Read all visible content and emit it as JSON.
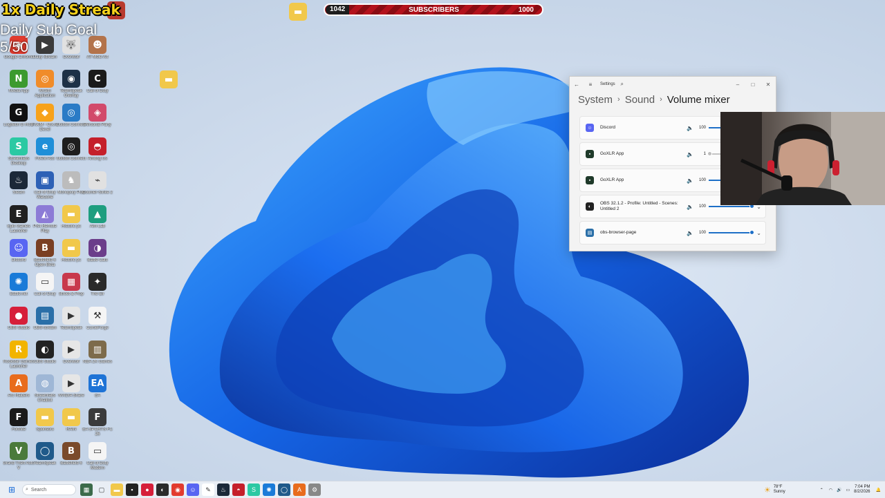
{
  "overlays": {
    "streak": "1x Daily Streak",
    "daily_goal_title": "Daily Sub Goal",
    "daily_goal_value": "5/50",
    "subs_current": "1042",
    "subs_label": "SUBSCRIBERS",
    "subs_target": "1000"
  },
  "desktop_icons": [
    {
      "label": "Google Chrome",
      "color": "#e23b2e",
      "glyph": "◉"
    },
    {
      "label": "Nvidia App",
      "color": "#3c9a2f",
      "glyph": "N"
    },
    {
      "label": "Logitech G HUB",
      "color": "#111111",
      "glyph": "G"
    },
    {
      "label": "Streamlabs Desktop",
      "color": "#2bc9a3",
      "glyph": "S"
    },
    {
      "label": "Steam",
      "color": "#1b2838",
      "glyph": "♨"
    },
    {
      "label": "Epic Games Launcher",
      "color": "#202020",
      "glyph": "E"
    },
    {
      "label": "Discord",
      "color": "#5865f2",
      "glyph": "☺"
    },
    {
      "label": "Battle.net",
      "color": "#1a7bd8",
      "glyph": "✺"
    },
    {
      "label": "OBS Studio",
      "color": "#d61f3a",
      "glyph": "●"
    },
    {
      "label": "Rockstar Games Launcher",
      "color": "#f2b400",
      "glyph": "R"
    },
    {
      "label": "Arc Raiders",
      "color": "#e86c1d",
      "glyph": "A"
    },
    {
      "label": "Fortnite",
      "color": "#1a1a1a",
      "glyph": "F"
    },
    {
      "label": "Grand Theft Auto V",
      "color": "#4a7a3b",
      "glyph": "V"
    }
  ],
  "desktop_icons_col2": [
    {
      "label": "Daily Stream",
      "color": "#3a3a3a",
      "glyph": "▶"
    },
    {
      "label": "Wraith Application",
      "color": "#f08c2a",
      "glyph": "◎"
    },
    {
      "label": "FiveM - Cfx.re Devel",
      "color": "#f7a21b",
      "glyph": "◆"
    },
    {
      "label": "FiveM Ass",
      "color": "#1f8fd8",
      "glyph": "e"
    },
    {
      "label": "Call of Duty Warzone",
      "color": "#2d61b6",
      "glyph": "▣"
    },
    {
      "label": "PS4 Remote Play",
      "color": "#8c7bd6",
      "glyph": "◭"
    },
    {
      "label": "Battlefield 6 Open Beta",
      "color": "#7a3f23",
      "glyph": "B"
    },
    {
      "label": "Call of Duty",
      "color": "#f5f5f5",
      "glyph": "▭"
    },
    {
      "label": "OBS-stream",
      "color": "#2a6fa8",
      "glyph": "▤"
    },
    {
      "label": "OBS Studio",
      "color": "#222222",
      "glyph": "◐"
    },
    {
      "label": "Streamlabs Chatbot",
      "color": "#9fb7d6",
      "glyph": "◍"
    },
    {
      "label": "Sponsors",
      "color": "#f1c84b",
      "glyph": "▬"
    },
    {
      "label": "TeamSpeak",
      "color": "#205a8a",
      "glyph": "◯"
    }
  ],
  "desktop_icons_col3": [
    {
      "label": "Overwolf",
      "color": "#e1e1e1",
      "glyph": "🐺"
    },
    {
      "label": "TeamSpeak Overlay",
      "color": "#1d3147",
      "glyph": "◉"
    },
    {
      "label": "Ubisoft Connect",
      "color": "#2a7bc6",
      "glyph": "◎"
    },
    {
      "label": "Ubisoft Connect",
      "color": "#1e1e1e",
      "glyph": "◎"
    },
    {
      "label": "Monopoly Plus",
      "color": "#bcbcbc",
      "glyph": "♞"
    },
    {
      "label": "Historic pc",
      "color": "#f1c84b",
      "glyph": "▬"
    },
    {
      "label": "Historic pc",
      "color": "#f1c84b",
      "glyph": "▬"
    },
    {
      "label": "Street & Prop",
      "color": "#c8384c",
      "glyph": "▦"
    },
    {
      "label": "TeamSpeak",
      "color": "#e6e6e6",
      "glyph": "▶"
    },
    {
      "label": "Overwolf",
      "color": "#e6e6e6",
      "glyph": "▶"
    },
    {
      "label": "NVIDIA Share",
      "color": "#e6e6e6",
      "glyph": "▶"
    },
    {
      "label": "RAIN",
      "color": "#f1c84b",
      "glyph": "▬"
    },
    {
      "label": "Battlefield 6",
      "color": "#7a4a2b",
      "glyph": "B"
    }
  ],
  "desktop_icons_col4": [
    {
      "label": "AT Mole Art",
      "color": "#b3734b",
      "glyph": "☻"
    },
    {
      "label": "Call of Duty",
      "color": "#1a1a1a",
      "glyph": "C"
    },
    {
      "label": "Personal Party",
      "color": "#d24a6b",
      "glyph": "◈"
    },
    {
      "label": "Among Us",
      "color": "#c51f2a",
      "glyph": "◓"
    },
    {
      "label": "Counter-Strike 2",
      "color": "#e1e1e1",
      "glyph": "⌁"
    },
    {
      "label": "Aim Lab",
      "color": "#1e9e7f",
      "glyph": "▲"
    },
    {
      "label": "Battle Cats",
      "color": "#6b3d8a",
      "glyph": "◑"
    },
    {
      "label": "The Elr",
      "color": "#2a2a2a",
      "glyph": "✦"
    },
    {
      "label": "CurseForge",
      "color": "#f5f5f5",
      "glyph": "⚒"
    },
    {
      "label": "NBA 2K Games",
      "color": "#7d6b4b",
      "glyph": "▥"
    },
    {
      "label": "EA",
      "color": "#1e73d6",
      "glyph": "EA"
    },
    {
      "label": "EA SPORTS FC 26",
      "color": "#3b3b3b",
      "glyph": "F"
    },
    {
      "label": "Call of Duty Modern",
      "color": "#f5f5f5",
      "glyph": "▭"
    }
  ],
  "settings": {
    "title": "Settings",
    "crumb_1": "System",
    "crumb_2": "Sound",
    "crumb_3": "Volume mixer",
    "apps": [
      {
        "name": "Discord",
        "volume": "100",
        "level": 1.0,
        "color": "#5865f2",
        "glyph": "☺"
      },
      {
        "name": "GoXLR App",
        "volume": "1",
        "level": 0.01,
        "color": "#1f3a2a",
        "glyph": "▪"
      },
      {
        "name": "GoXLR App",
        "volume": "100",
        "level": 1.0,
        "color": "#1f3a2a",
        "glyph": "▪"
      },
      {
        "name": "OBS 32.1.2 - Profile: Untitled - Scenes: Untitled 2",
        "volume": "100",
        "level": 1.0,
        "color": "#222222",
        "glyph": "◐"
      },
      {
        "name": "obs-browser-page",
        "volume": "100",
        "level": 1.0,
        "color": "#2a6fa8",
        "glyph": "▤"
      }
    ]
  },
  "taskbar": {
    "search_placeholder": "Search",
    "weather_temp": "78°F",
    "weather_desc": "Sunny",
    "time": "7:04 PM",
    "date": "8/2/2026"
  }
}
